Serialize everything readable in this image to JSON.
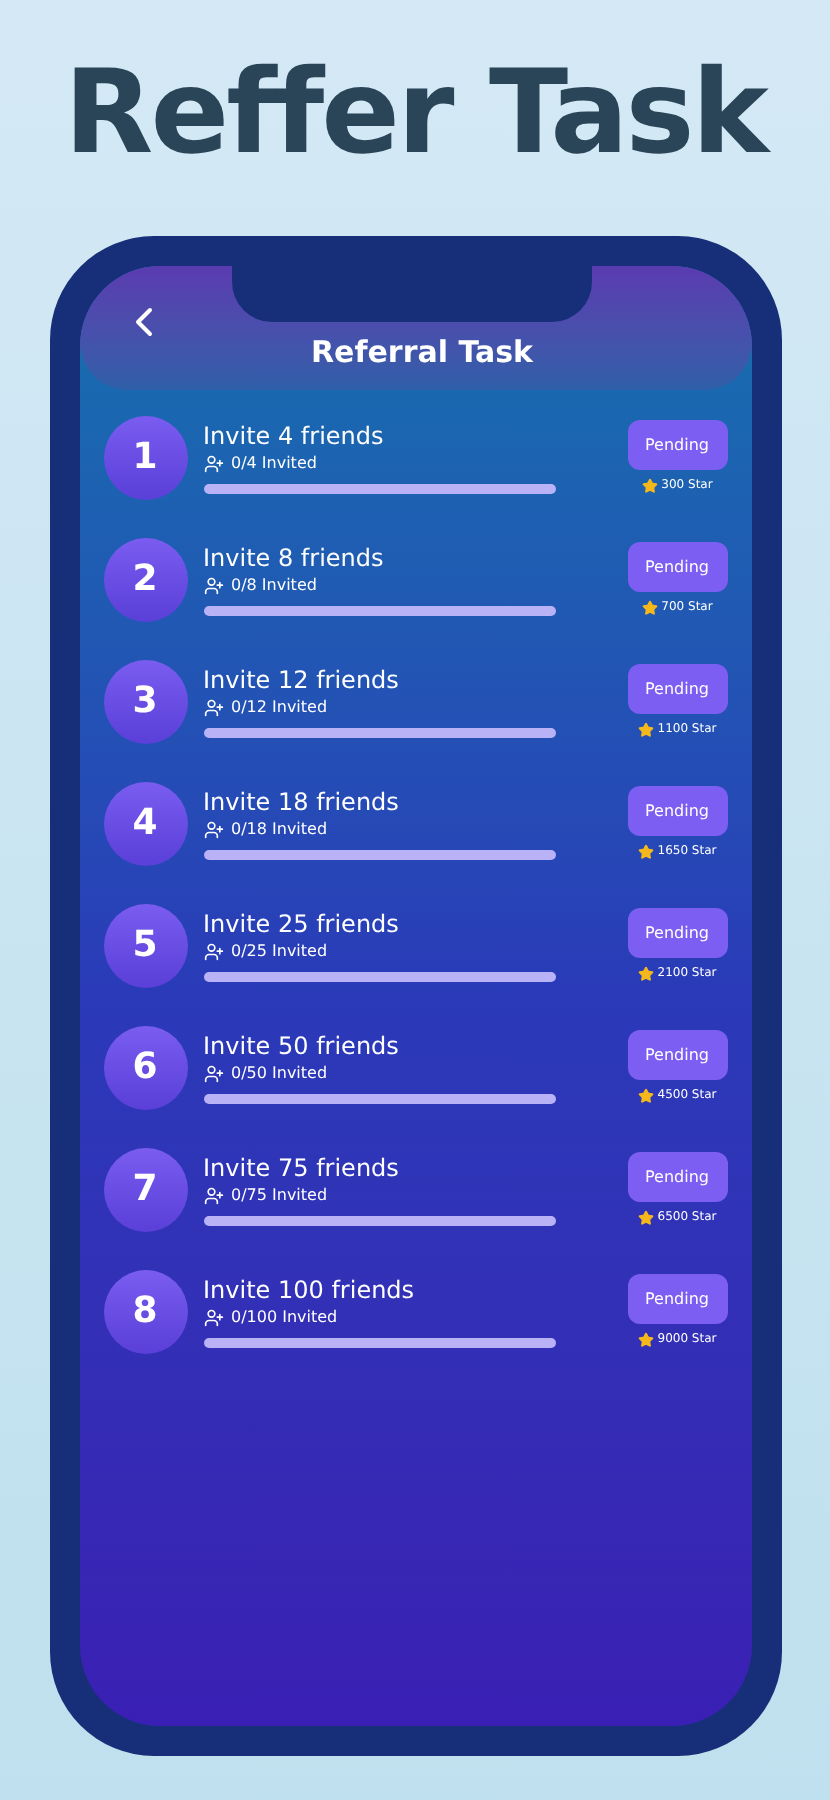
{
  "headline": "Reffer Task",
  "screen": {
    "title": "Referral Task",
    "tasks": [
      {
        "number": "1",
        "title": "Invite 4 friends",
        "invited": "0/4 Invited",
        "level": 0,
        "status": "Pending",
        "reward": "300 Star"
      },
      {
        "number": "2",
        "title": "Invite 8 friends",
        "invited": "0/8 Invited",
        "level": 0,
        "status": "Pending",
        "reward": "700 Star"
      },
      {
        "number": "3",
        "title": "Invite 12 friends",
        "invited": "0/12 Invited",
        "level": 0,
        "status": "Pending",
        "reward": "1100 Star"
      },
      {
        "number": "4",
        "title": "Invite 18 friends",
        "invited": "0/18 Invited",
        "level": 0,
        "status": "Pending",
        "reward": "1650 Star"
      },
      {
        "number": "5",
        "title": "Invite 25 friends",
        "invited": "0/25 Invited",
        "level": 0,
        "status": "Pending",
        "reward": "2100 Star"
      },
      {
        "number": "6",
        "title": "Invite 50 friends",
        "invited": "0/50 Invited",
        "level": 0,
        "status": "Pending",
        "reward": "4500 Star"
      },
      {
        "number": "7",
        "title": "Invite 75 friends",
        "invited": "0/75 Invited",
        "level": 0,
        "status": "Pending",
        "reward": "6500 Star"
      },
      {
        "number": "8",
        "title": "Invite 100 friends",
        "invited": "0/100 Invited",
        "level": 0,
        "status": "Pending",
        "reward": "9000 Star"
      }
    ]
  }
}
